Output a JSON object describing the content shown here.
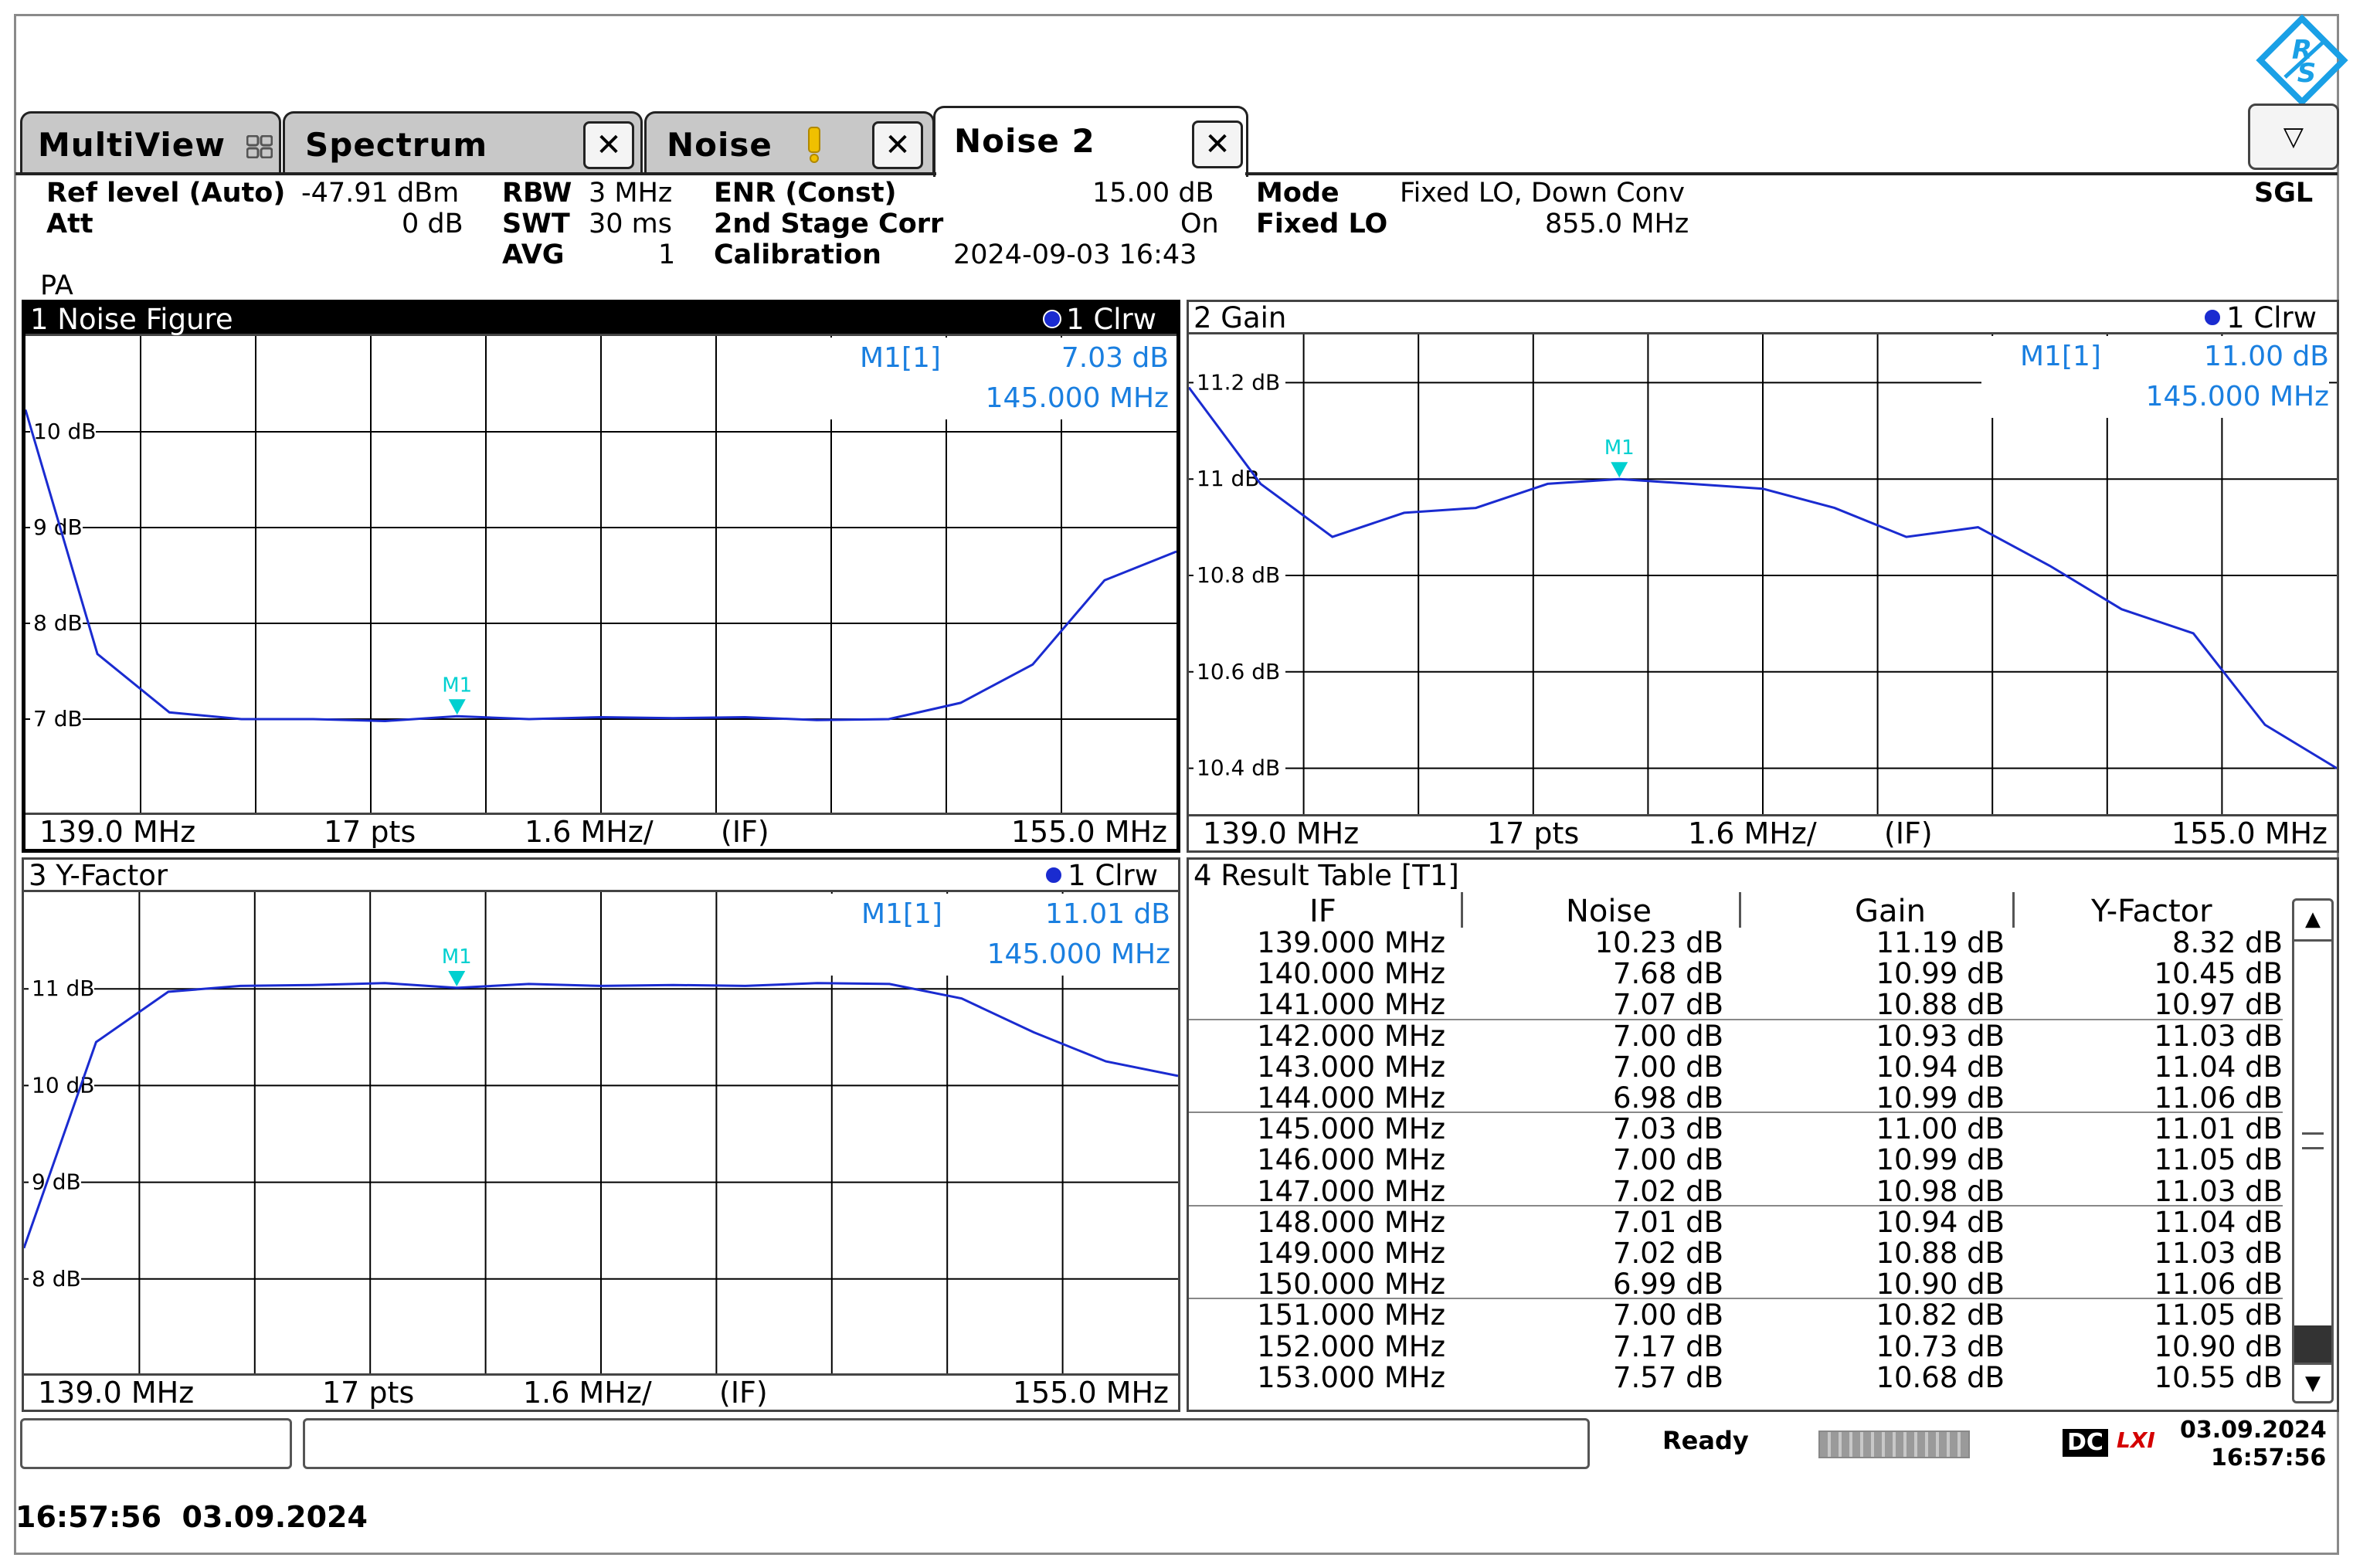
{
  "tabs": [
    {
      "label": "MultiView"
    },
    {
      "label": "Spectrum"
    },
    {
      "label": "Noise"
    },
    {
      "label": "Noise 2"
    }
  ],
  "icons": {
    "close": "✕",
    "dropdown": "▽",
    "warning": "!"
  },
  "header": {
    "ref_level_label": "Ref level (Auto)",
    "ref_level_value": "-47.91 dBm",
    "att_label": "Att",
    "att_value": "0 dB",
    "rbw_label": "RBW",
    "rbw_value": "3 MHz",
    "swt_label": "SWT",
    "swt_value": "30 ms",
    "avg_label": "AVG",
    "avg_value": "1",
    "enr_label": "ENR (Const)",
    "enr_value": "15.00 dB",
    "corr_label": "2nd Stage Corr",
    "corr_value": "On",
    "cal_label": "Calibration",
    "cal_value": "2024-09-03 16:43",
    "mode_label": "Mode",
    "mode_value": "Fixed LO, Down Conv",
    "lo_label": "Fixed LO",
    "lo_value": "855.0 MHz",
    "sgl": "SGL",
    "pa": "PA"
  },
  "panes": {
    "noise_figure": {
      "title": "1 Noise Figure",
      "trace": "1 Clrw",
      "marker_label": "M1[1]",
      "marker_value": "7.03 dB",
      "marker_freq": "145.000 MHz",
      "marker_tag": "M1",
      "foot_start": "139.0 MHz",
      "foot_pts": "17 pts",
      "foot_div": "1.6 MHz/",
      "foot_if": "(IF)",
      "foot_stop": "155.0 MHz"
    },
    "gain": {
      "title": "2 Gain",
      "trace": "1 Clrw",
      "marker_label": "M1[1]",
      "marker_value": "11.00 dB",
      "marker_freq": "145.000 MHz",
      "marker_tag": "M1",
      "foot_start": "139.0 MHz",
      "foot_pts": "17 pts",
      "foot_div": "1.6 MHz/",
      "foot_if": "(IF)",
      "foot_stop": "155.0 MHz"
    },
    "y_factor": {
      "title": "3 Y-Factor",
      "trace": "1 Clrw",
      "marker_label": "M1[1]",
      "marker_value": "11.01 dB",
      "marker_freq": "145.000 MHz",
      "marker_tag": "M1",
      "foot_start": "139.0 MHz",
      "foot_pts": "17 pts",
      "foot_div": "1.6 MHz/",
      "foot_if": "(IF)",
      "foot_stop": "155.0 MHz"
    },
    "result_table": {
      "title": "4 Result Table [T1]",
      "columns": [
        "IF",
        "Noise",
        "Gain",
        "Y-Factor"
      ]
    }
  },
  "chart_data": [
    {
      "type": "line",
      "title": "1 Noise Figure",
      "x": [
        139,
        140,
        141,
        142,
        143,
        144,
        145,
        146,
        147,
        148,
        149,
        150,
        151,
        152,
        153,
        154,
        155
      ],
      "series": [
        {
          "name": "1 Clrw",
          "values": [
            10.23,
            7.68,
            7.07,
            7.0,
            7.0,
            6.98,
            7.03,
            7.0,
            7.02,
            7.01,
            7.02,
            6.99,
            7.0,
            7.17,
            7.57,
            8.45,
            8.75
          ]
        }
      ],
      "ylim": [
        6.0,
        11.0
      ],
      "xlim": [
        139,
        155
      ],
      "yticks": [
        {
          "v": 10,
          "label": "10 dB"
        },
        {
          "v": 9,
          "label": "9 dB"
        },
        {
          "v": 8,
          "label": "8 dB"
        },
        {
          "v": 7,
          "label": "7 dB"
        }
      ],
      "marker": {
        "x": 145,
        "y": 7.03
      }
    },
    {
      "type": "line",
      "title": "2 Gain",
      "x": [
        139,
        140,
        141,
        142,
        143,
        144,
        145,
        146,
        147,
        148,
        149,
        150,
        151,
        152,
        153,
        154,
        155
      ],
      "series": [
        {
          "name": "1 Clrw",
          "values": [
            11.19,
            10.99,
            10.88,
            10.93,
            10.94,
            10.99,
            11.0,
            10.99,
            10.98,
            10.94,
            10.88,
            10.9,
            10.82,
            10.73,
            10.68,
            10.49,
            10.4
          ]
        }
      ],
      "ylim": [
        10.3,
        11.3
      ],
      "xlim": [
        139,
        155
      ],
      "yticks": [
        {
          "v": 11.2,
          "label": "11.2 dB"
        },
        {
          "v": 11.0,
          "label": "11 dB"
        },
        {
          "v": 10.8,
          "label": "10.8 dB"
        },
        {
          "v": 10.6,
          "label": "10.6 dB"
        },
        {
          "v": 10.4,
          "label": "10.4 dB"
        }
      ],
      "marker": {
        "x": 145,
        "y": 11.0
      }
    },
    {
      "type": "line",
      "title": "3 Y-Factor",
      "x": [
        139,
        140,
        141,
        142,
        143,
        144,
        145,
        146,
        147,
        148,
        149,
        150,
        151,
        152,
        153,
        154,
        155
      ],
      "series": [
        {
          "name": "1 Clrw",
          "values": [
            8.32,
            10.45,
            10.97,
            11.03,
            11.04,
            11.06,
            11.01,
            11.05,
            11.03,
            11.04,
            11.03,
            11.06,
            11.05,
            10.9,
            10.55,
            10.25,
            10.1
          ]
        }
      ],
      "ylim": [
        7.0,
        12.0
      ],
      "xlim": [
        139,
        155
      ],
      "yticks": [
        {
          "v": 11,
          "label": "11 dB"
        },
        {
          "v": 10,
          "label": "10 dB"
        },
        {
          "v": 9,
          "label": "9 dB"
        },
        {
          "v": 8,
          "label": "8 dB"
        }
      ],
      "marker": {
        "x": 145,
        "y": 11.01
      }
    },
    {
      "type": "table",
      "title": "4 Result Table [T1]",
      "columns": [
        "IF",
        "Noise",
        "Gain",
        "Y-Factor"
      ],
      "rows": [
        [
          "139.000 MHz",
          "10.23 dB",
          "11.19 dB",
          "8.32 dB"
        ],
        [
          "140.000 MHz",
          "7.68 dB",
          "10.99 dB",
          "10.45 dB"
        ],
        [
          "141.000 MHz",
          "7.07 dB",
          "10.88 dB",
          "10.97 dB"
        ],
        [
          "142.000 MHz",
          "7.00 dB",
          "10.93 dB",
          "11.03 dB"
        ],
        [
          "143.000 MHz",
          "7.00 dB",
          "10.94 dB",
          "11.04 dB"
        ],
        [
          "144.000 MHz",
          "6.98 dB",
          "10.99 dB",
          "11.06 dB"
        ],
        [
          "145.000 MHz",
          "7.03 dB",
          "11.00 dB",
          "11.01 dB"
        ],
        [
          "146.000 MHz",
          "7.00 dB",
          "10.99 dB",
          "11.05 dB"
        ],
        [
          "147.000 MHz",
          "7.02 dB",
          "10.98 dB",
          "11.03 dB"
        ],
        [
          "148.000 MHz",
          "7.01 dB",
          "10.94 dB",
          "11.04 dB"
        ],
        [
          "149.000 MHz",
          "7.02 dB",
          "10.88 dB",
          "11.03 dB"
        ],
        [
          "150.000 MHz",
          "6.99 dB",
          "10.90 dB",
          "11.06 dB"
        ],
        [
          "151.000 MHz",
          "7.00 dB",
          "10.82 dB",
          "11.05 dB"
        ],
        [
          "152.000 MHz",
          "7.17 dB",
          "10.73 dB",
          "10.90 dB"
        ],
        [
          "153.000 MHz",
          "7.57 dB",
          "10.68 dB",
          "10.55 dB"
        ]
      ]
    }
  ],
  "status": {
    "ready": "Ready",
    "dc": "DC",
    "lxi": "LXI",
    "date": "03.09.2024",
    "time": "16:57:56"
  },
  "footer_timestamp": "16:57:56  03.09.2024",
  "colors": {
    "trace": "#1a2bd0",
    "marker": "#00d0d0",
    "marker_text": "#1a7fe0",
    "logo": "#1aa0e6"
  }
}
